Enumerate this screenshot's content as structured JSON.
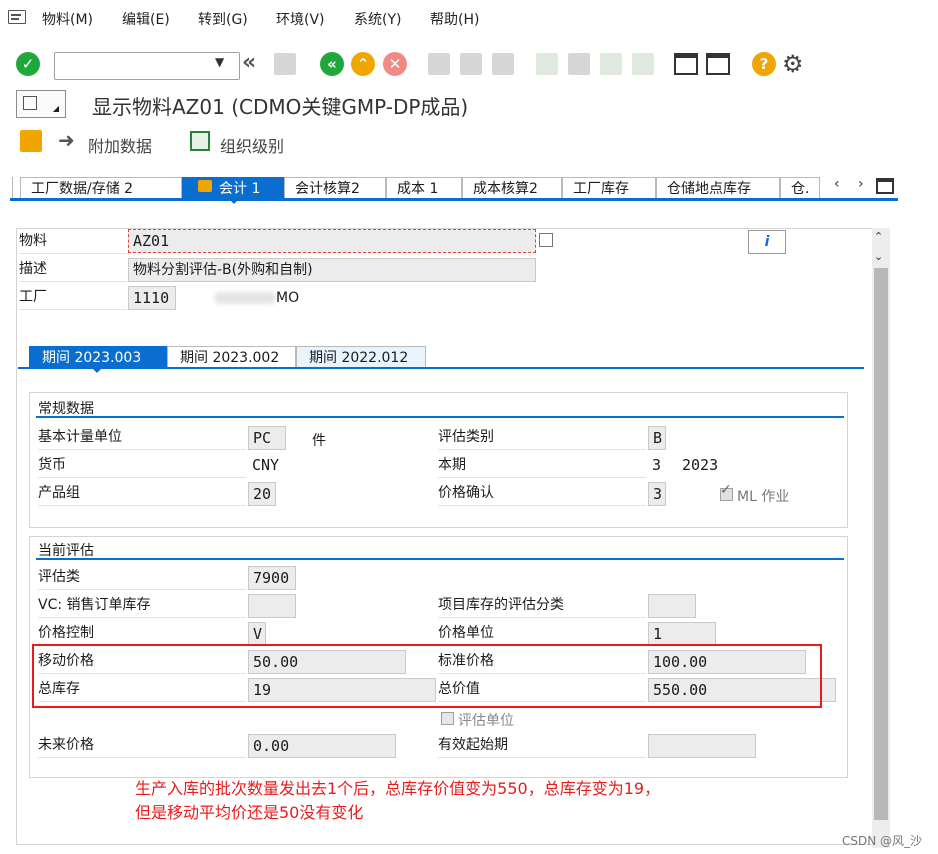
{
  "menu": {
    "items": [
      "物料(M)",
      "编辑(E)",
      "转到(G)",
      "环境(V)",
      "系统(Y)",
      "帮助(H)"
    ]
  },
  "toolbar": {
    "command_value": "",
    "icons": [
      "enter-icon",
      "command-dropdown-icon",
      "collapse-icon",
      "save-icon",
      "back-icon",
      "exit-icon",
      "cancel-icon",
      "print-icon",
      "find-icon",
      "find-next-icon",
      "first-page-icon",
      "previous-page-icon",
      "next-page-icon",
      "last-page-icon",
      "create-session-icon",
      "shortcut-icon",
      "help-icon",
      "settings-icon"
    ]
  },
  "title": "显示物料AZ01 (CDMO关键GMP-DP成品)",
  "app_toolbar": {
    "additional_data": "附加数据",
    "org_levels": "组织级别"
  },
  "tabs": [
    {
      "label": "工厂数据/存储 2",
      "active": false
    },
    {
      "label": "会计 1",
      "active": true
    },
    {
      "label": "会计核算2",
      "active": false
    },
    {
      "label": "成本 1",
      "active": false
    },
    {
      "label": "成本核算2",
      "active": false
    },
    {
      "label": "工厂库存",
      "active": false
    },
    {
      "label": "仓储地点库存",
      "active": false
    },
    {
      "label": "仓.",
      "active": false
    }
  ],
  "header": {
    "material_label": "物料",
    "material_value": "AZ01",
    "desc_label": "描述",
    "desc_value": "物料分割评估-B(外购和自制)",
    "plant_label": "工厂",
    "plant_value": "1110",
    "plant_name_visible": "MO"
  },
  "period_tabs": [
    {
      "label": "期间 2023.003",
      "active": true
    },
    {
      "label": "期间 2023.002",
      "active": false
    },
    {
      "label": "期间 2022.012",
      "active": false
    }
  ],
  "general": {
    "title": "常规数据",
    "base_uom_label": "基本计量单位",
    "base_uom_value": "PC",
    "base_uom_text": "件",
    "valuation_cat_label": "评估类别",
    "valuation_cat_value": "B",
    "currency_label": "货币",
    "currency_value": "CNY",
    "current_period_label": "本期",
    "current_period_value": "3",
    "current_year_value": "2023",
    "division_label": "产品组",
    "division_value": "20",
    "price_determination_label": "价格确认",
    "price_determination_value": "3",
    "ml_active_label": "ML 作业",
    "ml_active_checked": true
  },
  "current_valuation": {
    "title": "当前评估",
    "valuation_class_label": "评估类",
    "valuation_class_value": "7900",
    "vc_sales_label": "VC: 销售订单库存",
    "vc_sales_value": "",
    "proj_stock_label": "项目库存的评估分类",
    "proj_stock_value": "",
    "price_control_label": "价格控制",
    "price_control_value": "V",
    "price_unit_label": "价格单位",
    "price_unit_value": "1",
    "moving_price_label": "移动价格",
    "moving_price_value": "50.00",
    "standard_price_label": "标准价格",
    "standard_price_value": "100.00",
    "total_stock_label": "总库存",
    "total_stock_value": "19",
    "total_value_label": "总价值",
    "total_value_value": "550.00",
    "valuated_unit_label": "评估单位",
    "future_price_label": "未来价格",
    "future_price_value": "0.00",
    "valid_from_label": "有效起始期",
    "valid_from_value": ""
  },
  "annotation": {
    "line1": "生产入库的批次数量发出去1个后，总库存价值变为550，总库存变为19，",
    "line2": "但是移动平均价还是50没有变化"
  },
  "watermark": "CSDN @风_沙",
  "colors": {
    "sap_blue": "#0a6ed1",
    "highlight_red": "#e81c1c",
    "enter_green": "#20a83b",
    "back_green": "#20a83b",
    "exit_yellow": "#f0a500",
    "cancel_red": "#e0443a",
    "help_yellow": "#f0a500"
  }
}
